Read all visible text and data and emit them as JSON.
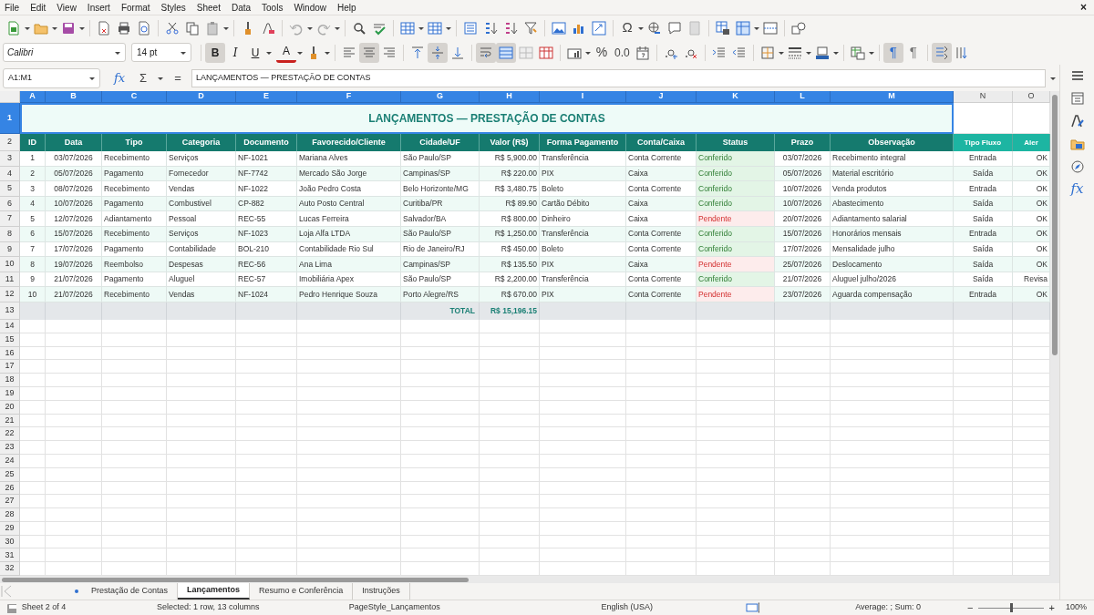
{
  "menu": [
    {
      "label": "File"
    },
    {
      "label": "Edit"
    },
    {
      "label": "View"
    },
    {
      "label": "Insert"
    },
    {
      "label": "Format"
    },
    {
      "label": "Styles"
    },
    {
      "label": "Sheet"
    },
    {
      "label": "Data"
    },
    {
      "label": "Tools"
    },
    {
      "label": "Window"
    },
    {
      "label": "Help"
    }
  ],
  "window_close": "×",
  "standard_toolbar": {
    "special_character": "Ω"
  },
  "formatting_toolbar": {
    "font_name": "Calibri",
    "font_size": "14 pt",
    "bold": {
      "label": "B",
      "selected": true
    },
    "italic": {
      "label": "I",
      "selected": false
    },
    "underline": {
      "label": "U",
      "selected": false
    },
    "font_color": {
      "label": "A"
    },
    "align": [
      {
        "kind": "left",
        "selected": false
      },
      {
        "kind": "center",
        "selected": true
      },
      {
        "kind": "right",
        "selected": false
      }
    ],
    "valign": [
      {
        "kind": "top",
        "selected": false
      },
      {
        "kind": "middle",
        "selected": true
      },
      {
        "kind": "bottom",
        "selected": false
      }
    ],
    "wrap_text": {
      "selected": true
    },
    "merge_center": {
      "selected": true
    },
    "percent": "%",
    "decimal": "0.0",
    "left_to_right": {
      "label": "¶",
      "selected": true
    },
    "right_to_left": {
      "label": "¶",
      "selected": false
    },
    "text_direction": {
      "selected": true
    }
  },
  "formula_bar": {
    "name_box": "A1:M1",
    "function_wizard": "fx",
    "sum": "Σ",
    "equals": "=",
    "content": "LANÇAMENTOS — PRESTAÇÃO DE CONTAS"
  },
  "sheet": {
    "columns": [
      {
        "letter": "A",
        "selected": true
      },
      {
        "letter": "B",
        "selected": true
      },
      {
        "letter": "C",
        "selected": true
      },
      {
        "letter": "D",
        "selected": true
      },
      {
        "letter": "E",
        "selected": true
      },
      {
        "letter": "F",
        "selected": true
      },
      {
        "letter": "G",
        "selected": true
      },
      {
        "letter": "H",
        "selected": true
      },
      {
        "letter": "I",
        "selected": true
      },
      {
        "letter": "J",
        "selected": true
      },
      {
        "letter": "K",
        "selected": true
      },
      {
        "letter": "L",
        "selected": true
      },
      {
        "letter": "M",
        "selected": true
      },
      {
        "letter": "N",
        "selected": false
      },
      {
        "letter": "O",
        "selected": false
      }
    ],
    "row_numbers": [
      {
        "label": "1",
        "selected": true
      },
      {
        "label": "2",
        "selected": false
      },
      {
        "label": "3",
        "selected": false
      },
      {
        "label": "4",
        "selected": false
      },
      {
        "label": "5",
        "selected": false
      },
      {
        "label": "6",
        "selected": false
      },
      {
        "label": "7",
        "selected": false
      },
      {
        "label": "8",
        "selected": false
      },
      {
        "label": "9",
        "selected": false
      },
      {
        "label": "10",
        "selected": false
      },
      {
        "label": "11",
        "selected": false
      },
      {
        "label": "12",
        "selected": false
      },
      {
        "label": "13",
        "selected": false
      },
      {
        "label": "14",
        "selected": false
      },
      {
        "label": "15",
        "selected": false
      },
      {
        "label": "16",
        "selected": false
      },
      {
        "label": "17",
        "selected": false
      },
      {
        "label": "18",
        "selected": false
      },
      {
        "label": "19",
        "selected": false
      },
      {
        "label": "20",
        "selected": false
      },
      {
        "label": "21",
        "selected": false
      },
      {
        "label": "22",
        "selected": false
      },
      {
        "label": "23",
        "selected": false
      },
      {
        "label": "24",
        "selected": false
      },
      {
        "label": "25",
        "selected": false
      },
      {
        "label": "26",
        "selected": false
      },
      {
        "label": "27",
        "selected": false
      },
      {
        "label": "28",
        "selected": false
      },
      {
        "label": "29",
        "selected": false
      },
      {
        "label": "30",
        "selected": false
      },
      {
        "label": "31",
        "selected": false
      },
      {
        "label": "32",
        "selected": false
      }
    ],
    "title": "LANÇAMENTOS — PRESTAÇÃO DE CONTAS",
    "headers": [
      {
        "label": "ID",
        "color": "#157a6e"
      },
      {
        "label": "Data",
        "color": "#157a6e"
      },
      {
        "label": "Tipo",
        "color": "#157a6e"
      },
      {
        "label": "Categoria",
        "color": "#157a6e"
      },
      {
        "label": "Documento",
        "color": "#157a6e"
      },
      {
        "label": "Favorecido/Cliente",
        "color": "#157a6e"
      },
      {
        "label": "Cidade/UF",
        "color": "#157a6e"
      },
      {
        "label": "Valor (R$)",
        "color": "#157a6e"
      },
      {
        "label": "Forma Pagamento",
        "color": "#157a6e"
      },
      {
        "label": "Conta/Caixa",
        "color": "#157a6e"
      },
      {
        "label": "Status",
        "color": "#157a6e"
      },
      {
        "label": "Prazo",
        "color": "#157a6e"
      },
      {
        "label": "Observação",
        "color": "#157a6e"
      },
      {
        "label": "Tipo Fluxo",
        "color": "#1db5a2"
      },
      {
        "label": "Aler",
        "color": "#1db5a2"
      }
    ],
    "rows": [
      {
        "cells": [
          "1",
          "03/07/2026",
          "Recebimento",
          "Serviços",
          "NF-1021",
          "Mariana Alves",
          "São Paulo/SP",
          "R$ 5,900.00",
          "Transferência",
          "Conta Corrente",
          "Conferido",
          "03/07/2026",
          "Recebimento integral",
          "Entrada",
          "OK"
        ],
        "status_ok": true
      },
      {
        "cells": [
          "2",
          "05/07/2026",
          "Pagamento",
          "Fornecedor",
          "NF-7742",
          "Mercado São Jorge",
          "Campinas/SP",
          "R$ 220.00",
          "PIX",
          "Caixa",
          "Conferido",
          "05/07/2026",
          "Material escritório",
          "Saída",
          "OK"
        ],
        "status_ok": true
      },
      {
        "cells": [
          "3",
          "08/07/2026",
          "Recebimento",
          "Vendas",
          "NF-1022",
          "João Pedro Costa",
          "Belo Horizonte/MG",
          "R$ 3,480.75",
          "Boleto",
          "Conta Corrente",
          "Conferido",
          "10/07/2026",
          "Venda produtos",
          "Entrada",
          "OK"
        ],
        "status_ok": true
      },
      {
        "cells": [
          "4",
          "10/07/2026",
          "Pagamento",
          "Combustivel",
          "CP-882",
          "Auto Posto Central",
          "Curitiba/PR",
          "R$ 89.90",
          "Cartão Débito",
          "Caixa",
          "Conferido",
          "10/07/2026",
          "Abastecimento",
          "Saída",
          "OK"
        ],
        "status_ok": true
      },
      {
        "cells": [
          "5",
          "12/07/2026",
          "Adiantamento",
          "Pessoal",
          "REC-55",
          "Lucas Ferreira",
          "Salvador/BA",
          "R$ 800.00",
          "Dinheiro",
          "Caixa",
          "Pendente",
          "20/07/2026",
          "Adiantamento salarial",
          "Saída",
          "OK"
        ],
        "status_ok": false
      },
      {
        "cells": [
          "6",
          "15/07/2026",
          "Recebimento",
          "Serviços",
          "NF-1023",
          "Loja Alfa LTDA",
          "São Paulo/SP",
          "R$ 1,250.00",
          "Transferência",
          "Conta Corrente",
          "Conferido",
          "15/07/2026",
          "Honorários mensais",
          "Entrada",
          "OK"
        ],
        "status_ok": true
      },
      {
        "cells": [
          "7",
          "17/07/2026",
          "Pagamento",
          "Contabilidade",
          "BOL-210",
          "Contabilidade Rio Sul",
          "Rio de Janeiro/RJ",
          "R$ 450.00",
          "Boleto",
          "Conta Corrente",
          "Conferido",
          "17/07/2026",
          "Mensalidade julho",
          "Saída",
          "OK"
        ],
        "status_ok": true
      },
      {
        "cells": [
          "8",
          "19/07/2026",
          "Reembolso",
          "Despesas",
          "REC-56",
          "Ana Lima",
          "Campinas/SP",
          "R$ 135.50",
          "PIX",
          "Caixa",
          "Pendente",
          "25/07/2026",
          "Deslocamento",
          "Saída",
          "OK"
        ],
        "status_ok": false
      },
      {
        "cells": [
          "9",
          "21/07/2026",
          "Pagamento",
          "Aluguel",
          "REC-57",
          "Imobiliária Apex",
          "São Paulo/SP",
          "R$ 2,200.00",
          "Transferência",
          "Conta Corrente",
          "Conferido",
          "21/07/2026",
          "Aluguel julho/2026",
          "Saída",
          "Revisa"
        ],
        "status_ok": true
      },
      {
        "cells": [
          "10",
          "21/07/2026",
          "Recebimento",
          "Vendas",
          "NF-1024",
          "Pedro Henrique Souza",
          "Porto Alegre/RS",
          "R$ 670.00",
          "PIX",
          "Conta Corrente",
          "Pendente",
          "23/07/2026",
          "Aguarda compensação",
          "Entrada",
          "OK"
        ],
        "status_ok": false
      }
    ],
    "total": {
      "label": "TOTAL",
      "value": "R$ 15,196.15"
    }
  },
  "sidebar": {
    "functions": "fx"
  },
  "sheet_tabs": [
    {
      "label": "Prestação de Contas",
      "selected": false
    },
    {
      "label": "Lançamentos",
      "selected": true
    },
    {
      "label": "Resumo e Conferência",
      "selected": false
    },
    {
      "label": "Instruções",
      "selected": false
    }
  ],
  "status_bar": {
    "sheet": "Sheet 2 of 4",
    "selection": "Selected: 1 row, 13 columns",
    "page_style": "PageStyle_Lançamentos",
    "language": "English (USA)",
    "sum": "Average: ; Sum: 0",
    "zoom_out": "−",
    "zoom_in": "+",
    "zoom_slider": {
      "level": 0.5
    },
    "zoom": "100%"
  }
}
